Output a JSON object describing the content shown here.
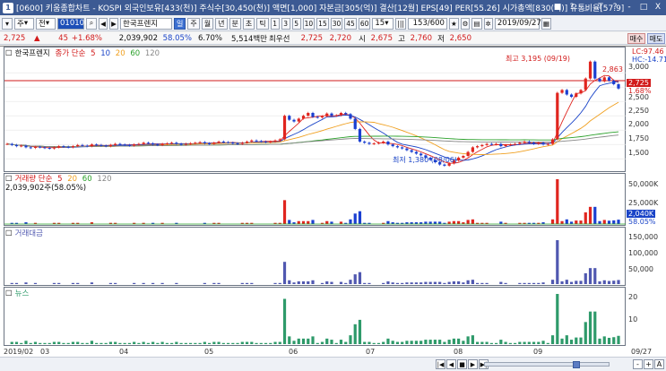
{
  "window": {
    "icon_label": "1",
    "title": "[0600] 키움종합차트 - KOSPI 외국인보유[433(천)] 주식수[30,450(천)] 액면[1,000] 자본금[305(억)] 결산[12월] EPS[49] PER[55.26] 시가총액[830(억)] 유통비율[57.9]",
    "buttons": [
      "■",
      "?",
      "_",
      "T",
      "?",
      "-",
      "□",
      "X"
    ]
  },
  "toolbar": {
    "menu_label": "주",
    "jeon_label": "전",
    "code": "010100",
    "company": "한국프렌지",
    "periods": [
      "일",
      "주",
      "월",
      "년",
      "분",
      "초",
      "틱"
    ],
    "selected_period": "일",
    "intervals": [
      "1",
      "3",
      "5",
      "10",
      "15",
      "30",
      "45",
      "60"
    ],
    "interval_select": "15",
    "count": "153",
    "count_max": "/600",
    "date": "2019/09/27"
  },
  "infobar": {
    "price": "2,725",
    "change": "45",
    "change_pct": "+1.68%",
    "volume": "2,039,902",
    "vol_pct": "58.05%",
    "turnover_ratio": "6.70%",
    "amount": "5,514백만",
    "best_label": "최우선",
    "ask": "2,725",
    "bid": "2,720",
    "open_label": "시",
    "open": "2,675",
    "high_label": "고",
    "high": "2,760",
    "low_label": "저",
    "low": "2,650",
    "buy_label": "매수",
    "sell_label": "매도"
  },
  "price_panel": {
    "legend_title": "한국프렌지",
    "legend_ma_label": "종가 단순",
    "ma_periods": [
      "5",
      "10",
      "20",
      "60",
      "120"
    ],
    "lc": "LC:97.46",
    "hc": "HC:-14.71",
    "high_annotation": "최고 3,195 (09/19)",
    "low_annotation": "최저 1,380 (08/06)",
    "right_val": "2,863",
    "current_price": "2,725",
    "current_pct": "1.68%",
    "y_ticks": [
      "3,000",
      "2,750",
      "2,500",
      "2,250",
      "2,000",
      "1,750",
      "1,500"
    ]
  },
  "volume_panel": {
    "legend": "거래량 단순",
    "ma_periods": [
      "5",
      "20",
      "60",
      "120"
    ],
    "value_line": "2,039,902주(58.05%)",
    "y_ticks": [
      "50,000K",
      "25,000K"
    ],
    "current": "2,040K",
    "current_pct": "58.05%"
  },
  "amount_panel": {
    "legend": "거래대금",
    "y_ticks": [
      "150,000",
      "100,000",
      "50,000"
    ]
  },
  "news_panel": {
    "legend": "뉴스",
    "y_ticks": [
      "20",
      "10"
    ]
  },
  "x_axis": {
    "labels": [
      "2019/02",
      "03",
      "04",
      "05",
      "06",
      "07",
      "08",
      "09"
    ],
    "right_label": "09/27"
  },
  "bottom": {
    "nav": [
      "|◀",
      "◀",
      "■",
      "▶",
      "▶|",
      "◀",
      "▶"
    ],
    "zoom": [
      "-",
      "+",
      "A"
    ]
  },
  "colors": {
    "up": "#e0251f",
    "down": "#1a3fd1",
    "ma5": "#e0251f",
    "ma10": "#1a44c8",
    "ma20": "#f0a020",
    "ma60": "#2aa02a",
    "ma120": "#888888",
    "news": "#2e9a6a",
    "amount": "#5058b0"
  },
  "chart_data": {
    "type": "candlestick",
    "y_range_price": [
      1300,
      3300
    ],
    "price_series": [
      1760,
      1740,
      1720,
      1730,
      1700,
      1690,
      1710,
      1700,
      1690,
      1680,
      1700,
      1720,
      1710,
      1700,
      1720,
      1740,
      1730,
      1720,
      1750,
      1740,
      1730,
      1720,
      1740,
      1760,
      1750,
      1740,
      1730,
      1750,
      1760,
      1780,
      1770,
      1750,
      1740,
      1760,
      1770,
      1780,
      1760,
      1750,
      1760,
      1770,
      1780,
      1790,
      1770,
      1760,
      1780,
      1800,
      1790,
      1780,
      1770,
      1760,
      1780,
      1800,
      1820,
      1810,
      1800,
      1790,
      1800,
      1820,
      1840,
      2250,
      2180,
      2150,
      2200,
      2250,
      2300,
      2230,
      2220,
      2240,
      2290,
      2250,
      2260,
      2300,
      2280,
      2200,
      2020,
      1800,
      1780,
      1760,
      1770,
      1780,
      1800,
      1750,
      1720,
      1700,
      1680,
      1650,
      1620,
      1590,
      1560,
      1520,
      1480,
      1440,
      1400,
      1380,
      1420,
      1470,
      1520,
      1550,
      1620,
      1700,
      1720,
      1740,
      1760,
      1750,
      1760,
      1720,
      1740,
      1750,
      1760,
      1780,
      1800,
      1780,
      1760,
      1780,
      1750,
      1760,
      1840,
      2650,
      2700,
      2620,
      2580,
      2640,
      2700,
      2900,
      3195,
      2900,
      2850,
      2920,
      2863,
      2800,
      2725
    ]
  }
}
